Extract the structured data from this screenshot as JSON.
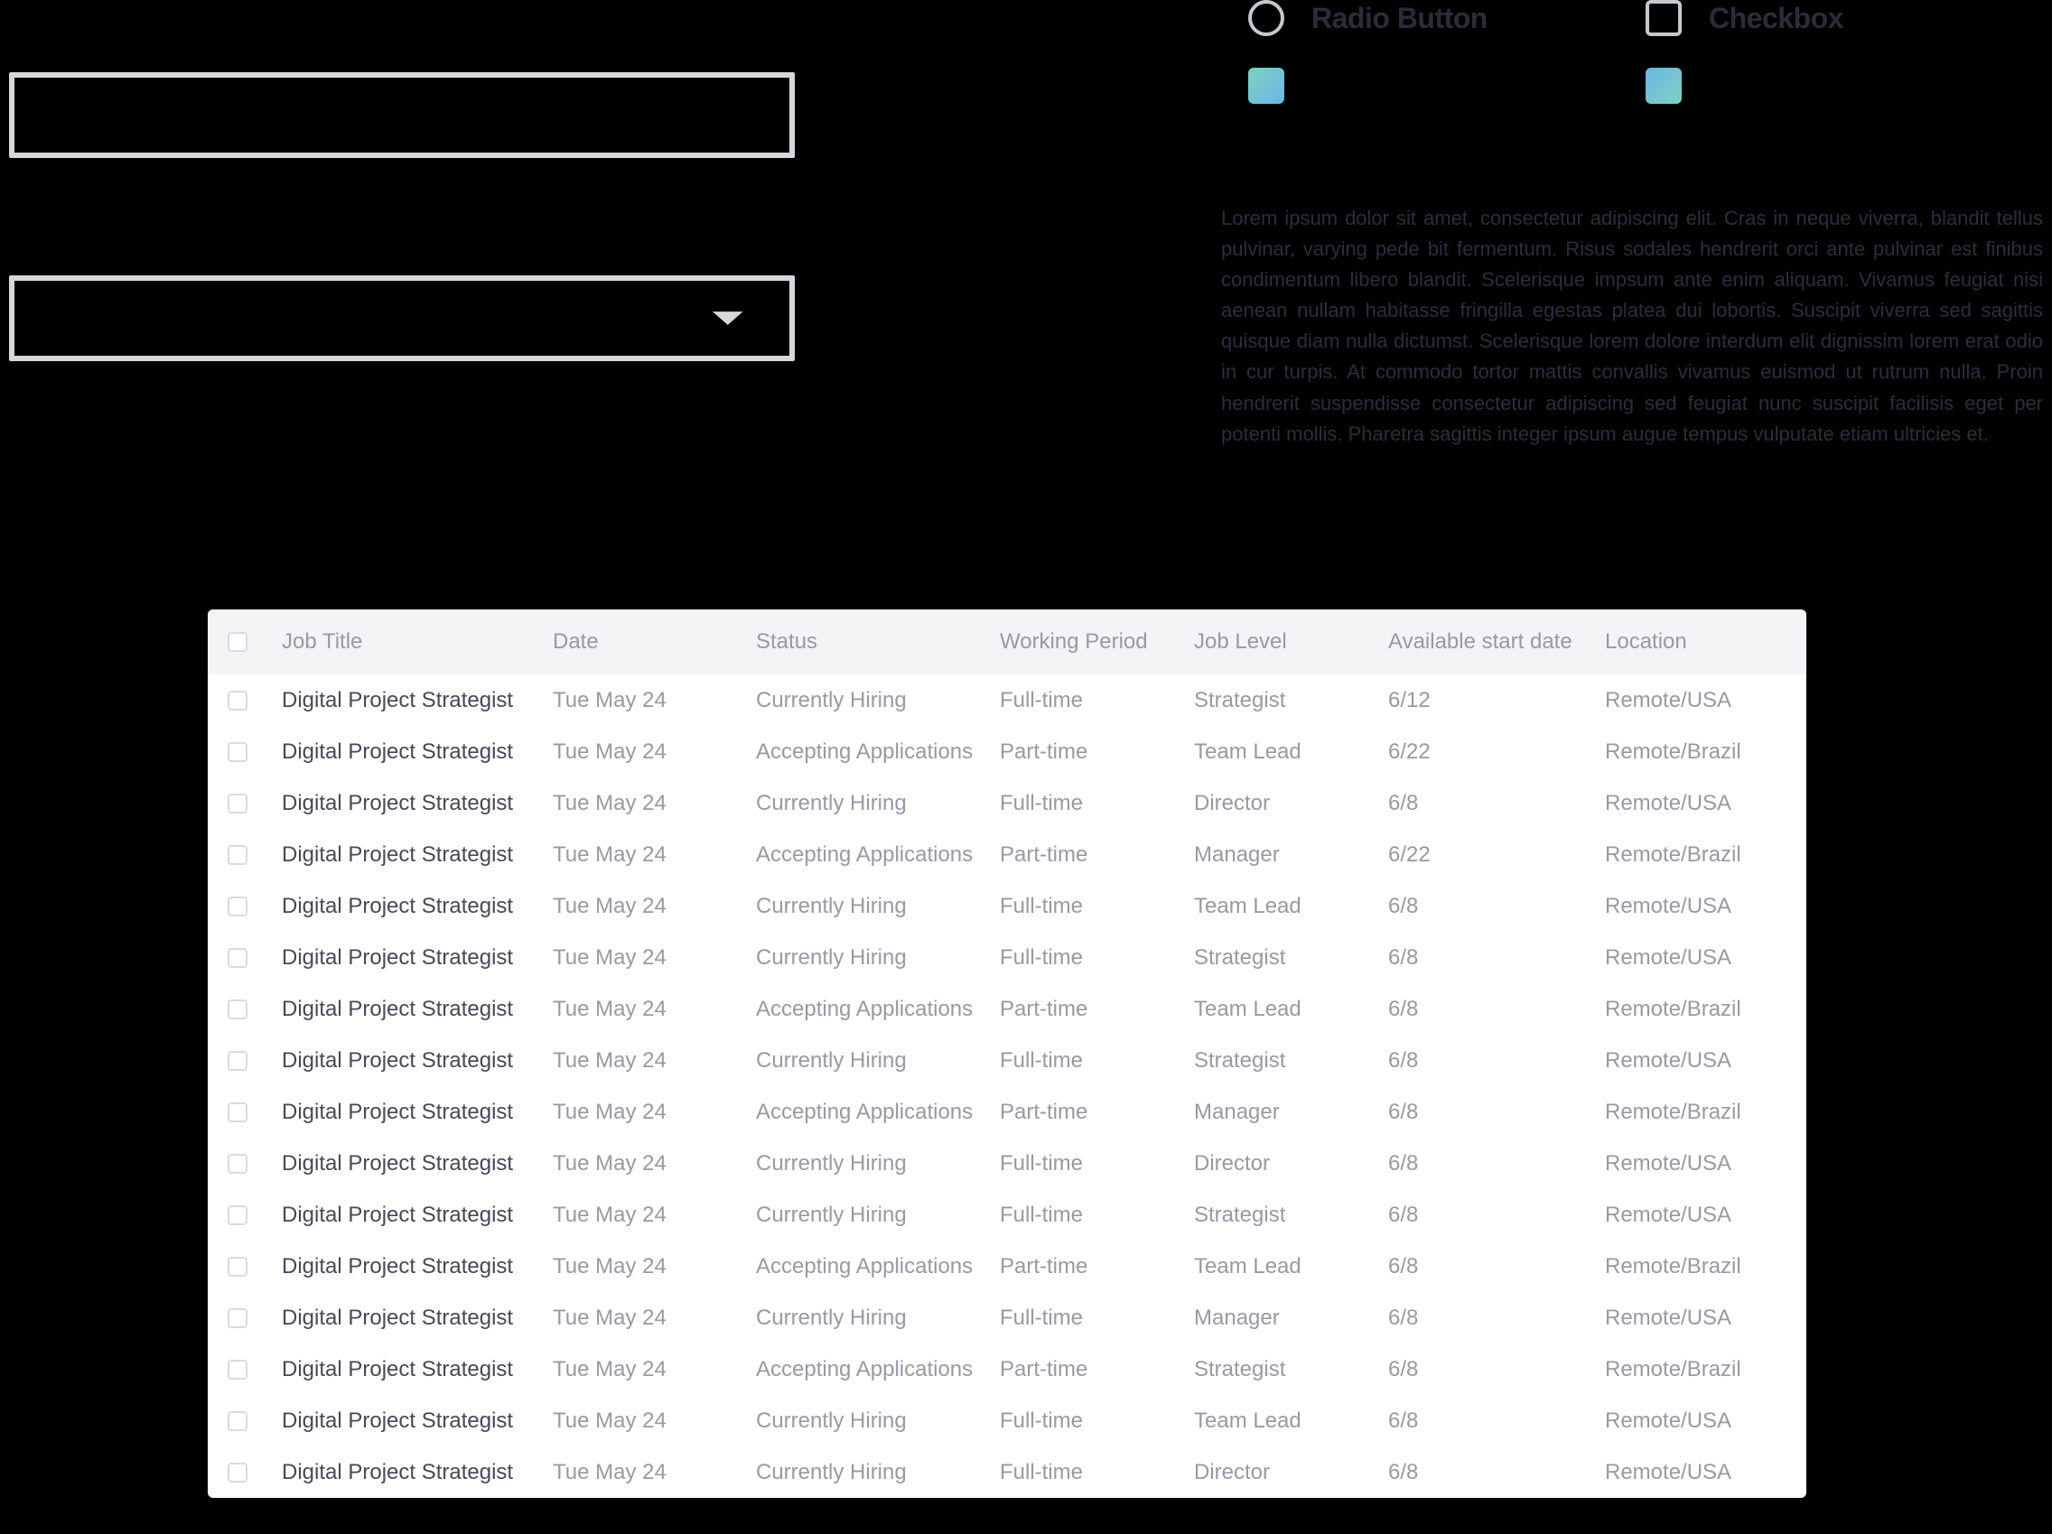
{
  "palette": {
    "radio_label": "Radio Button",
    "checkbox_label": "Checkbox",
    "toggle_label": "",
    "switch_label": ""
  },
  "lorem": "Lorem ipsum dolor sit amet, consectetur adipiscing elit. Cras in neque viverra, blandit tellus pulvinar, varying pede bit fermentum. Risus sodales hendrerit orci ante pulvinar est finibus condimentum libero blandit. Scelerisque impsum ante enim aliquam. Vivamus feugiat nisi aenean nullam habitasse fringilla egestas platea dui lobortis. Suscipit viverra sed sagittis quisque diam nulla dictumst. Scelerisque lorem dolore interdum elit dignissim lorem erat odio in cur turpis. At commodo tortor mattis convallis vivamus euismod ut rutrum nulla. Proin hendrerit suspendisse consectetur adipiscing sed feugiat nunc suscipit facilisis eget per potenti mollis. Pharetra sagittis integer ipsum augue tempus vulputate etiam ultricies et.",
  "table": {
    "headers": {
      "title": "Job Title",
      "date": "Date",
      "status": "Status",
      "period": "Working Period",
      "level": "Job Level",
      "start": "Available start date",
      "location": "Location"
    },
    "rows": [
      {
        "title": "Digital Project Strategist",
        "date": "Tue May 24",
        "status": "Currently Hiring",
        "period": "Full-time",
        "level": "Strategist",
        "start": "6/12",
        "location": "Remote/USA"
      },
      {
        "title": "Digital Project Strategist",
        "date": "Tue May 24",
        "status": "Accepting Applications",
        "period": "Part-time",
        "level": "Team Lead",
        "start": "6/22",
        "location": "Remote/Brazil"
      },
      {
        "title": "Digital Project Strategist",
        "date": "Tue May 24",
        "status": "Currently Hiring",
        "period": "Full-time",
        "level": "Director",
        "start": "6/8",
        "location": "Remote/USA"
      },
      {
        "title": "Digital Project Strategist",
        "date": "Tue May 24",
        "status": "Accepting Applications",
        "period": "Part-time",
        "level": "Manager",
        "start": "6/22",
        "location": "Remote/Brazil"
      },
      {
        "title": "Digital Project Strategist",
        "date": "Tue May 24",
        "status": "Currently Hiring",
        "period": "Full-time",
        "level": "Team Lead",
        "start": "6/8",
        "location": "Remote/USA"
      },
      {
        "title": "Digital Project Strategist",
        "date": "Tue May 24",
        "status": "Currently Hiring",
        "period": "Full-time",
        "level": "Strategist",
        "start": "6/8",
        "location": "Remote/USA"
      },
      {
        "title": "Digital Project Strategist",
        "date": "Tue May 24",
        "status": "Accepting Applications",
        "period": "Part-time",
        "level": "Team Lead",
        "start": "6/8",
        "location": "Remote/Brazil"
      },
      {
        "title": "Digital Project Strategist",
        "date": "Tue May 24",
        "status": "Currently Hiring",
        "period": "Full-time",
        "level": "Strategist",
        "start": "6/8",
        "location": "Remote/USA"
      },
      {
        "title": "Digital Project Strategist",
        "date": "Tue May 24",
        "status": "Accepting Applications",
        "period": "Part-time",
        "level": "Manager",
        "start": "6/8",
        "location": "Remote/Brazil"
      },
      {
        "title": "Digital Project Strategist",
        "date": "Tue May 24",
        "status": "Currently Hiring",
        "period": "Full-time",
        "level": "Director",
        "start": "6/8",
        "location": "Remote/USA"
      },
      {
        "title": "Digital Project Strategist",
        "date": "Tue May 24",
        "status": "Currently Hiring",
        "period": "Full-time",
        "level": "Strategist",
        "start": "6/8",
        "location": "Remote/USA"
      },
      {
        "title": "Digital Project Strategist",
        "date": "Tue May 24",
        "status": "Accepting Applications",
        "period": "Part-time",
        "level": "Team Lead",
        "start": "6/8",
        "location": "Remote/Brazil"
      },
      {
        "title": "Digital Project Strategist",
        "date": "Tue May 24",
        "status": "Currently Hiring",
        "period": "Full-time",
        "level": "Manager",
        "start": "6/8",
        "location": "Remote/USA"
      },
      {
        "title": "Digital Project Strategist",
        "date": "Tue May 24",
        "status": "Accepting Applications",
        "period": "Part-time",
        "level": "Strategist",
        "start": "6/8",
        "location": "Remote/Brazil"
      },
      {
        "title": "Digital Project Strategist",
        "date": "Tue May 24",
        "status": "Currently Hiring",
        "period": "Full-time",
        "level": "Team Lead",
        "start": "6/8",
        "location": "Remote/USA"
      },
      {
        "title": "Digital Project Strategist",
        "date": "Tue May 24",
        "status": "Currently Hiring",
        "period": "Full-time",
        "level": "Director",
        "start": "6/8",
        "location": "Remote/USA"
      }
    ]
  }
}
